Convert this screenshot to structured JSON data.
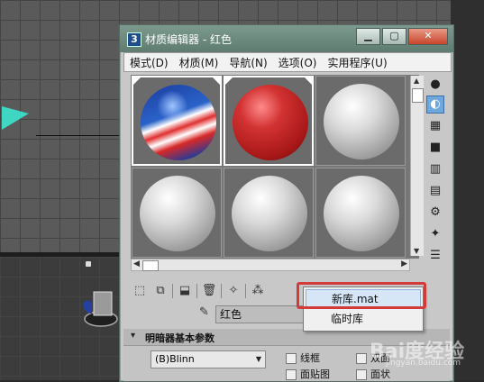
{
  "window": {
    "app_badge": "3",
    "title": "材质编辑器 - 红色",
    "minimize": "▁",
    "maximize": "▢",
    "close": "✕"
  },
  "menubar": {
    "items": [
      "模式(D)",
      "材质(M)",
      "导航(N)",
      "选项(O)",
      "实用程序(U)"
    ]
  },
  "slots": {
    "spheres": [
      "ball",
      "red",
      "gray",
      "gray",
      "gray",
      "gray"
    ],
    "selected_index": 1
  },
  "side_tools": [
    "sphere-icon",
    "backlight-icon",
    "checker-icon",
    "background-icon",
    "color-bars-icon",
    "video-check-icon",
    "options-icon",
    "select-by-material-icon",
    "material-map-navigator-icon"
  ],
  "toolbar": {
    "icons": [
      "get-material-icon",
      "put-to-scene-icon",
      "assign-to-selection-icon",
      "delete-icon",
      "make-unique-icon",
      "material-id-icon"
    ]
  },
  "material": {
    "name": "红色"
  },
  "rollout": {
    "toggle": "▾",
    "title": "明暗器基本参数",
    "shader": "(B)Blinn",
    "checkbox_wire": "线框",
    "checkbox_two_sided": "双面",
    "checkbox_face_map": "面贴图",
    "checkbox_faceted": "面状"
  },
  "popup": {
    "items": [
      "新库.mat",
      "临时库"
    ]
  },
  "watermark": {
    "logo": "Bai度经验",
    "url": "jingyan.baidu.com"
  }
}
